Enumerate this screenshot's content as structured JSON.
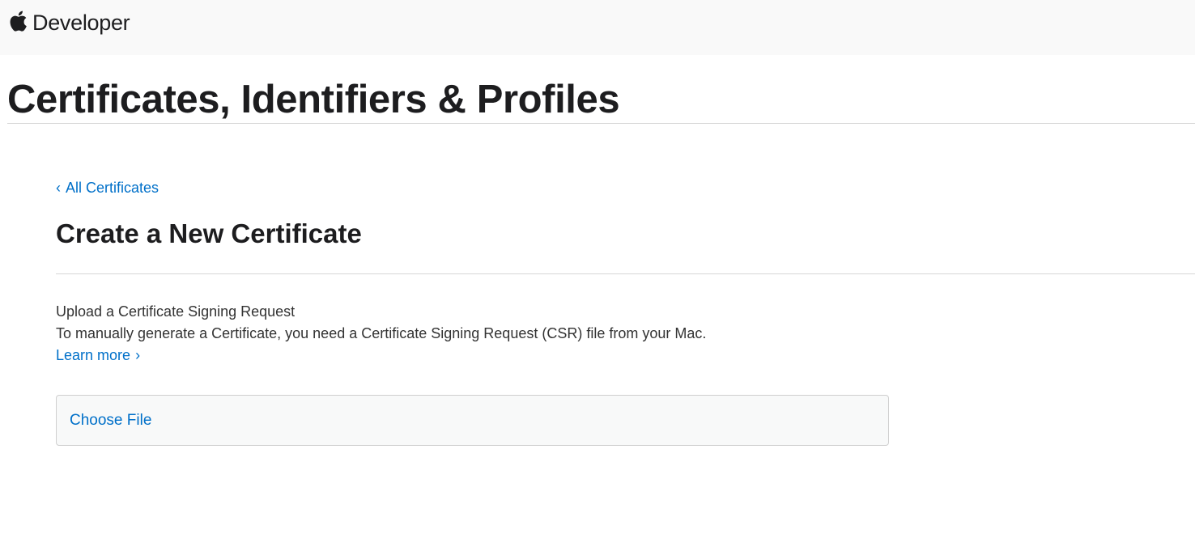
{
  "header": {
    "brand_label": "Developer"
  },
  "page": {
    "title": "Certificates, Identifiers & Profiles"
  },
  "main": {
    "back_link": {
      "chevron": "‹",
      "label": "All Certificates"
    },
    "heading": "Create a New Certificate",
    "upload": {
      "heading": "Upload a Certificate Signing Request",
      "description": "To manually generate a Certificate, you need a Certificate Signing Request (CSR) file from your Mac.",
      "learn_more_label": "Learn more",
      "learn_more_chevron": "›",
      "choose_file_label": "Choose File"
    }
  },
  "icons": {
    "apple_logo": "apple-logo-icon"
  },
  "colors": {
    "link": "#0070c9",
    "text": "#1d1d1f",
    "nav_background": "#f9f9f9",
    "rule": "#d6d6d6"
  }
}
